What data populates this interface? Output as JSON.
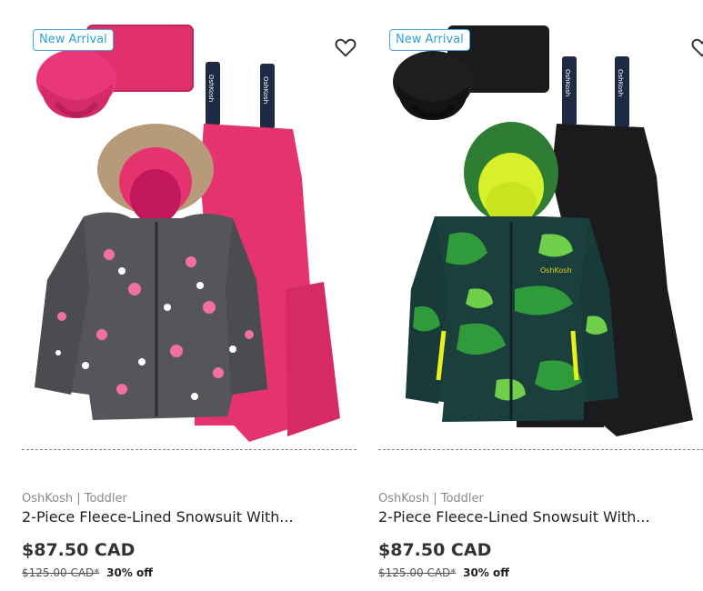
{
  "products": [
    {
      "badge": "New Arrival",
      "brand_line": "OshKosh | Toddler",
      "name": "2-Piece Fleece-Lined Snowsuit With...",
      "price": "$87.50 CAD",
      "original_price": "$125.00 CAD*",
      "discount": "30% off",
      "favorite_icon": "heart-outline-icon",
      "image": "pink-floral-snowsuit"
    },
    {
      "badge": "New Arrival",
      "brand_line": "OshKosh | Toddler",
      "name": "2-Piece Fleece-Lined Snowsuit With...",
      "price": "$87.50 CAD",
      "original_price": "$125.00 CAD*",
      "discount": "30% off",
      "favorite_icon": "heart-outline-icon",
      "image": "green-camo-snowsuit"
    }
  ],
  "colors": {
    "badge_border": "#3fa9d9",
    "pink": "#e2306f",
    "jacket_grey": "#55565a",
    "camo_green": "#2f9b3a",
    "black": "#1b1b1d"
  }
}
